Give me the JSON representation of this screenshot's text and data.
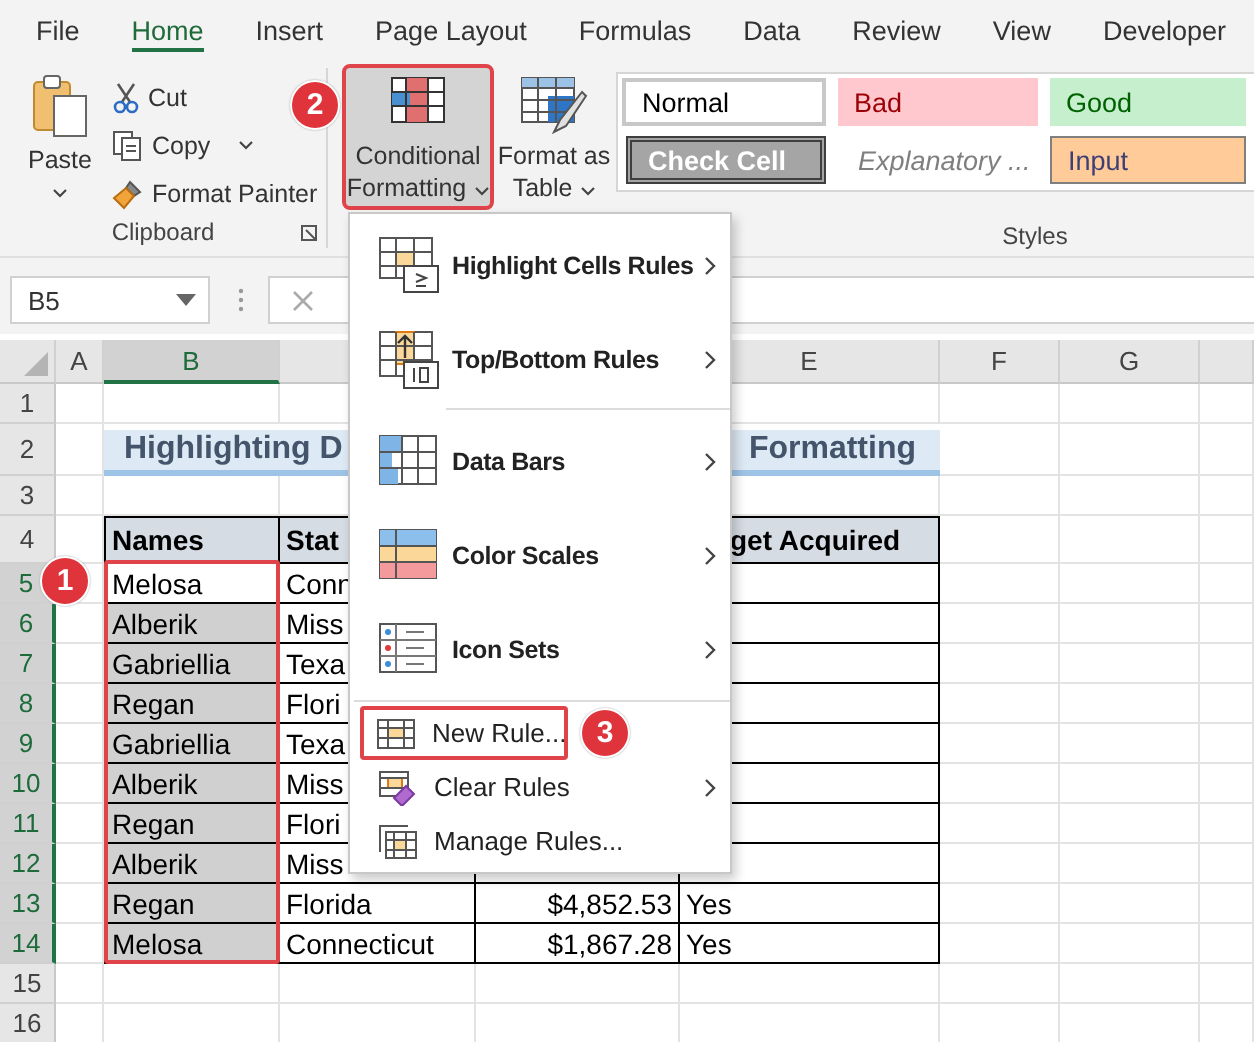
{
  "tabs": [
    {
      "label": "File",
      "selected": false
    },
    {
      "label": "Home",
      "selected": true
    },
    {
      "label": "Insert",
      "selected": false
    },
    {
      "label": "Page Layout",
      "selected": false
    },
    {
      "label": "Formulas",
      "selected": false
    },
    {
      "label": "Data",
      "selected": false
    },
    {
      "label": "Review",
      "selected": false
    },
    {
      "label": "View",
      "selected": false
    },
    {
      "label": "Developer",
      "selected": false
    }
  ],
  "ribbon": {
    "clipboard": {
      "paste": "Paste",
      "cut": "Cut",
      "copy": "Copy",
      "format_painter": "Format Painter",
      "label": "Clipboard"
    },
    "conditional_formatting": {
      "label_line_1": "Conditional",
      "label_line_2": "Formatting",
      "pressed": true,
      "outlined": true
    },
    "format_as_table": {
      "label_line_1": "Format as",
      "label_line_2": "Table"
    },
    "styles": {
      "label": "Styles",
      "items": [
        {
          "label": "Normal",
          "kind": "normal"
        },
        {
          "label": "Bad",
          "kind": "bad"
        },
        {
          "label": "Good",
          "kind": "good"
        },
        {
          "label": "Check Cell",
          "kind": "check"
        },
        {
          "label": "Explanatory ...",
          "kind": "explanatory"
        },
        {
          "label": "Input",
          "kind": "input"
        }
      ]
    }
  },
  "name_box": "B5",
  "columns": [
    {
      "label": "A",
      "selected": false
    },
    {
      "label": "B",
      "selected": true
    },
    {
      "selected": false
    },
    {
      "label": "E",
      "selected": false
    },
    {
      "label": "F",
      "selected": false
    },
    {
      "label": "G",
      "selected": false
    }
  ],
  "rows": [
    {
      "number": "1",
      "selected": false
    },
    {
      "number": "2",
      "selected": false,
      "kind": "title",
      "cells": {
        "B": "Highlighting D",
        "E": "Formatting"
      }
    },
    {
      "number": "3",
      "selected": false
    },
    {
      "number": "4",
      "selected": false,
      "kind": "header",
      "cells": {
        "B": "Names",
        "C": "Stat",
        "E": "get Acquired"
      }
    },
    {
      "number": "5",
      "selected": true,
      "active": true,
      "kind": "data",
      "cells": {
        "B": "Melosa",
        "C": "Conn"
      }
    },
    {
      "number": "6",
      "selected": true,
      "kind": "data",
      "cells": {
        "B": "Alberik",
        "C": "Miss"
      }
    },
    {
      "number": "7",
      "selected": true,
      "kind": "data",
      "cells": {
        "B": "Gabriellia",
        "C": "Texa"
      }
    },
    {
      "number": "8",
      "selected": true,
      "kind": "data",
      "cells": {
        "B": "Regan",
        "C": "Flori"
      }
    },
    {
      "number": "9",
      "selected": true,
      "kind": "data",
      "cells": {
        "B": "Gabriellia",
        "C": "Texa"
      }
    },
    {
      "number": "10",
      "selected": true,
      "kind": "data",
      "cells": {
        "B": "Alberik",
        "C": "Miss"
      }
    },
    {
      "number": "11",
      "selected": true,
      "kind": "data",
      "cells": {
        "B": "Regan",
        "C": "Flori"
      }
    },
    {
      "number": "12",
      "selected": true,
      "kind": "data",
      "cells": {
        "B": "Alberik",
        "C": "Miss"
      }
    },
    {
      "number": "13",
      "selected": true,
      "kind": "data",
      "cells": {
        "B": "Regan",
        "C": "Florida",
        "D": "$4,852.53",
        "E": "Yes"
      }
    },
    {
      "number": "14",
      "selected": true,
      "kind": "data",
      "cells": {
        "B": "Melosa",
        "C": "Connecticut",
        "D": "$1,867.28",
        "E": "Yes"
      }
    },
    {
      "number": "15",
      "selected": false
    },
    {
      "number": "16",
      "selected": false
    }
  ],
  "menu": {
    "items": [
      {
        "label": "Highlight Cells Rules",
        "kind": "large",
        "submenu": true,
        "outlined": false
      },
      {
        "label": "Top/Bottom Rules",
        "kind": "large",
        "submenu": true,
        "outlined": false
      },
      {
        "label": "Data Bars",
        "kind": "large",
        "submenu": true,
        "outlined": false
      },
      {
        "label": "Color Scales",
        "kind": "large",
        "submenu": true,
        "outlined": false
      },
      {
        "label": "Icon Sets",
        "kind": "large",
        "submenu": true,
        "outlined": false
      },
      {
        "label": "New Rule...",
        "kind": "small",
        "submenu": false,
        "outlined": true
      },
      {
        "label": "Clear Rules",
        "kind": "small",
        "submenu": true,
        "outlined": false
      },
      {
        "label": "Manage Rules...",
        "kind": "small",
        "submenu": false,
        "outlined": false
      }
    ]
  },
  "callouts": [
    {
      "label": "1"
    },
    {
      "label": "2"
    },
    {
      "label": "3"
    }
  ]
}
